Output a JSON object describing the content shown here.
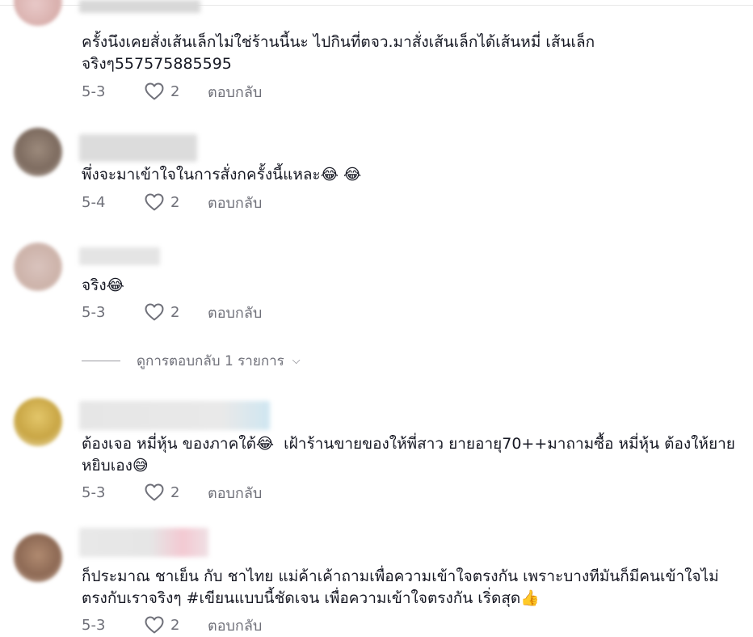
{
  "comments": [
    {
      "text": "ครั้งนึงเคยสั่งเส้นเล็กไม่ใช่ร้านนี้นะ ไปกินที่ตจว.มาสั่งเส้นเล็กได้เส้นหมี่ เส้นเล็กจริงๆ557575885595",
      "date": "5-3",
      "likes": "2",
      "reply": "ตอบกลับ"
    },
    {
      "text": "พึ่งจะมาเข้าใจในการสั่งกครั้งนี้แหละ😂 😂",
      "date": "5-4",
      "likes": "2",
      "reply": "ตอบกลับ"
    },
    {
      "text": "จริง😂",
      "date": "5-3",
      "likes": "2",
      "reply": "ตอบกลับ"
    },
    {
      "text": "ต้องเจอ หมี่หุ้น ของภาคใต้😂  เฝ้าร้านขายของให้พี่สาว ยายอายุ70++มาถามซื้อ หมี่หุ้น ต้องให้ยายหยิบเอง😅",
      "date": "5-3",
      "likes": "2",
      "reply": "ตอบกลับ"
    },
    {
      "text": "ก็ประมาณ ชาเย็น กับ ชาไทย แม่ค้าเค้าถามเพื่อความเข้าใจตรงกัน เพราะบางทีมันก็มีคนเข้าใจไม่ตรงกับเราจริงๆ #เขียนแบบนี้ชัดเจน เพื่อความเข้าใจตรงกัน เริ่ดสุด👍",
      "date": "5-3",
      "likes": "2",
      "reply": "ตอบกลับ"
    }
  ],
  "view_replies": {
    "label": "ดูการตอบกลับ 1 รายการ"
  },
  "colors": {
    "text": "#161823",
    "meta": "#6f7079"
  }
}
